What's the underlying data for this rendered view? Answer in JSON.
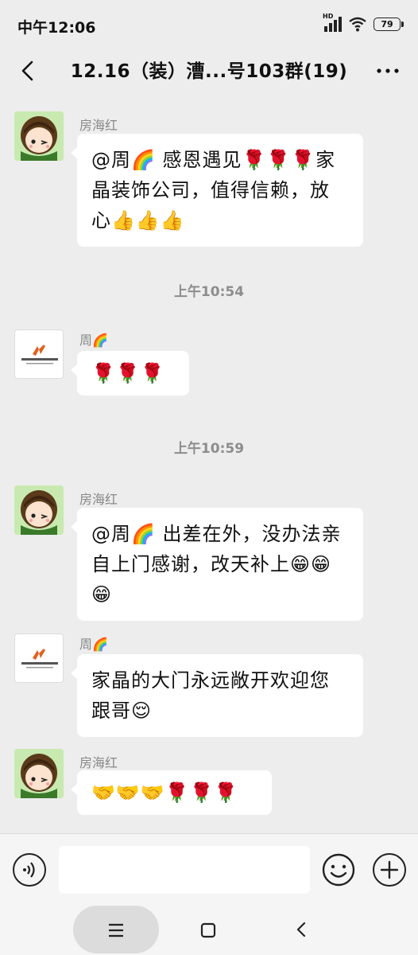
{
  "status": {
    "time": "中午12:06",
    "network_label": "HD",
    "battery": "79"
  },
  "header": {
    "title": "12.16（装）漕...号103群(19)"
  },
  "messages": [
    {
      "sender": "房海红",
      "text": "@周🌈 感恩遇见🌹🌹🌹家晶装饰公司，值得信赖，放心👍👍👍"
    },
    {
      "sender": "周🌈",
      "text": "🌹🌹🌹"
    },
    {
      "sender": "房海红",
      "text": "@周🌈 出差在外，没办法亲自上门感谢，改天补上😁😁😁"
    },
    {
      "sender": "周🌈",
      "text": "家晶的大门永远敞开欢迎您跟哥😌"
    },
    {
      "sender": "房海红",
      "text": "🤝🤝🤝🌹🌹🌹"
    }
  ],
  "timestamps": [
    "上午10:54",
    "上午10:59"
  ],
  "icons": {
    "back": "back-chevron-icon",
    "more": "more-dots-icon",
    "voice": "voice-icon",
    "emoji": "emoji-icon",
    "plus": "plus-icon",
    "menu": "menu-icon",
    "home": "home-square-icon",
    "navback": "nav-back-icon"
  },
  "colors": {
    "background": "#ededed",
    "bubble": "#ffffff",
    "secondary_text": "#888888"
  }
}
